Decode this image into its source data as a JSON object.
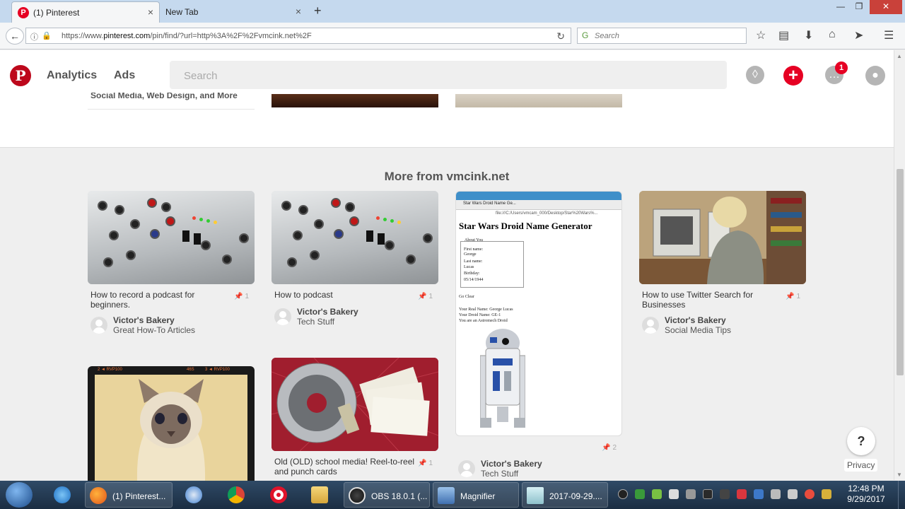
{
  "browser": {
    "tabs": [
      {
        "title": "(1) Pinterest",
        "close": "×"
      },
      {
        "title": "New Tab",
        "close": "×"
      }
    ],
    "new_tab": "+",
    "window": {
      "minimize": "—",
      "maximize": "❐",
      "close": "✕"
    },
    "url_prefix": "https://www.",
    "url_domain": "pinterest.com",
    "url_rest": "/pin/find/?url=http%3A%2F%2Fvmcink.net%2F",
    "search_placeholder": "Search"
  },
  "pinterest": {
    "logo": "P",
    "nav": {
      "analytics": "Analytics",
      "ads": "Ads"
    },
    "search_placeholder": "Search",
    "notification_count": "1",
    "prev_card_text": "Social Media, Web Design, and More"
  },
  "section_title": "More from vmcink.net",
  "pins": [
    {
      "title": "How to record a podcast for beginners.",
      "saves": "1",
      "author": "Victor's Bakery",
      "board": "Great How-To Articles"
    },
    {
      "title": "How to podcast",
      "saves": "1",
      "author": "Victor's Bakery",
      "board": "Tech Stuff"
    },
    {
      "title": "",
      "saves": "2",
      "author": "Victor's Bakery",
      "board": "Tech Stuff",
      "screenshot": {
        "tab": "Star Wars Droid Name Ge...",
        "address": "file:///C:/Users/vmcam_000/Desktop/Star%20Wars%...",
        "heading": "Star Wars Droid Name Generator",
        "legend": "About You",
        "fields": [
          "First name:",
          "George",
          "Last name:",
          "Lucas",
          "Birthday:",
          "05/14/1944"
        ],
        "buttons": "Go  Clear",
        "result": [
          "Your Real Name: George Lucas",
          "Your Droid Name: GE-1",
          "You are an Astromech Droid"
        ]
      }
    },
    {
      "title": "How to use Twitter Search for Businesses",
      "saves": "1",
      "author": "Victor's Bakery",
      "board": "Social Media Tips"
    },
    {
      "title": "",
      "saves": "",
      "author": "",
      "board": "",
      "film_left": "2 ◄ RVP100",
      "film_mid": "46S",
      "film_right": "3 ◄ RVP100"
    },
    {
      "title": "Old (OLD) school media! Reel-to-reel and punch cards",
      "saves": "1",
      "author": "",
      "board": ""
    }
  ],
  "help": {
    "label": "?",
    "privacy": "Privacy"
  },
  "taskbar": {
    "items": [
      {
        "label": "(1) Pinterest..."
      },
      {
        "label": "OBS 18.0.1 (..."
      },
      {
        "label": "Magnifier"
      },
      {
        "label": "2017-09-29...."
      }
    ],
    "time": "12:48 PM",
    "date": "9/29/2017"
  },
  "colors": {
    "pinterest_red": "#e60023",
    "tab_bg": "#c5d9ee",
    "taskbar": "#1b2d42"
  }
}
